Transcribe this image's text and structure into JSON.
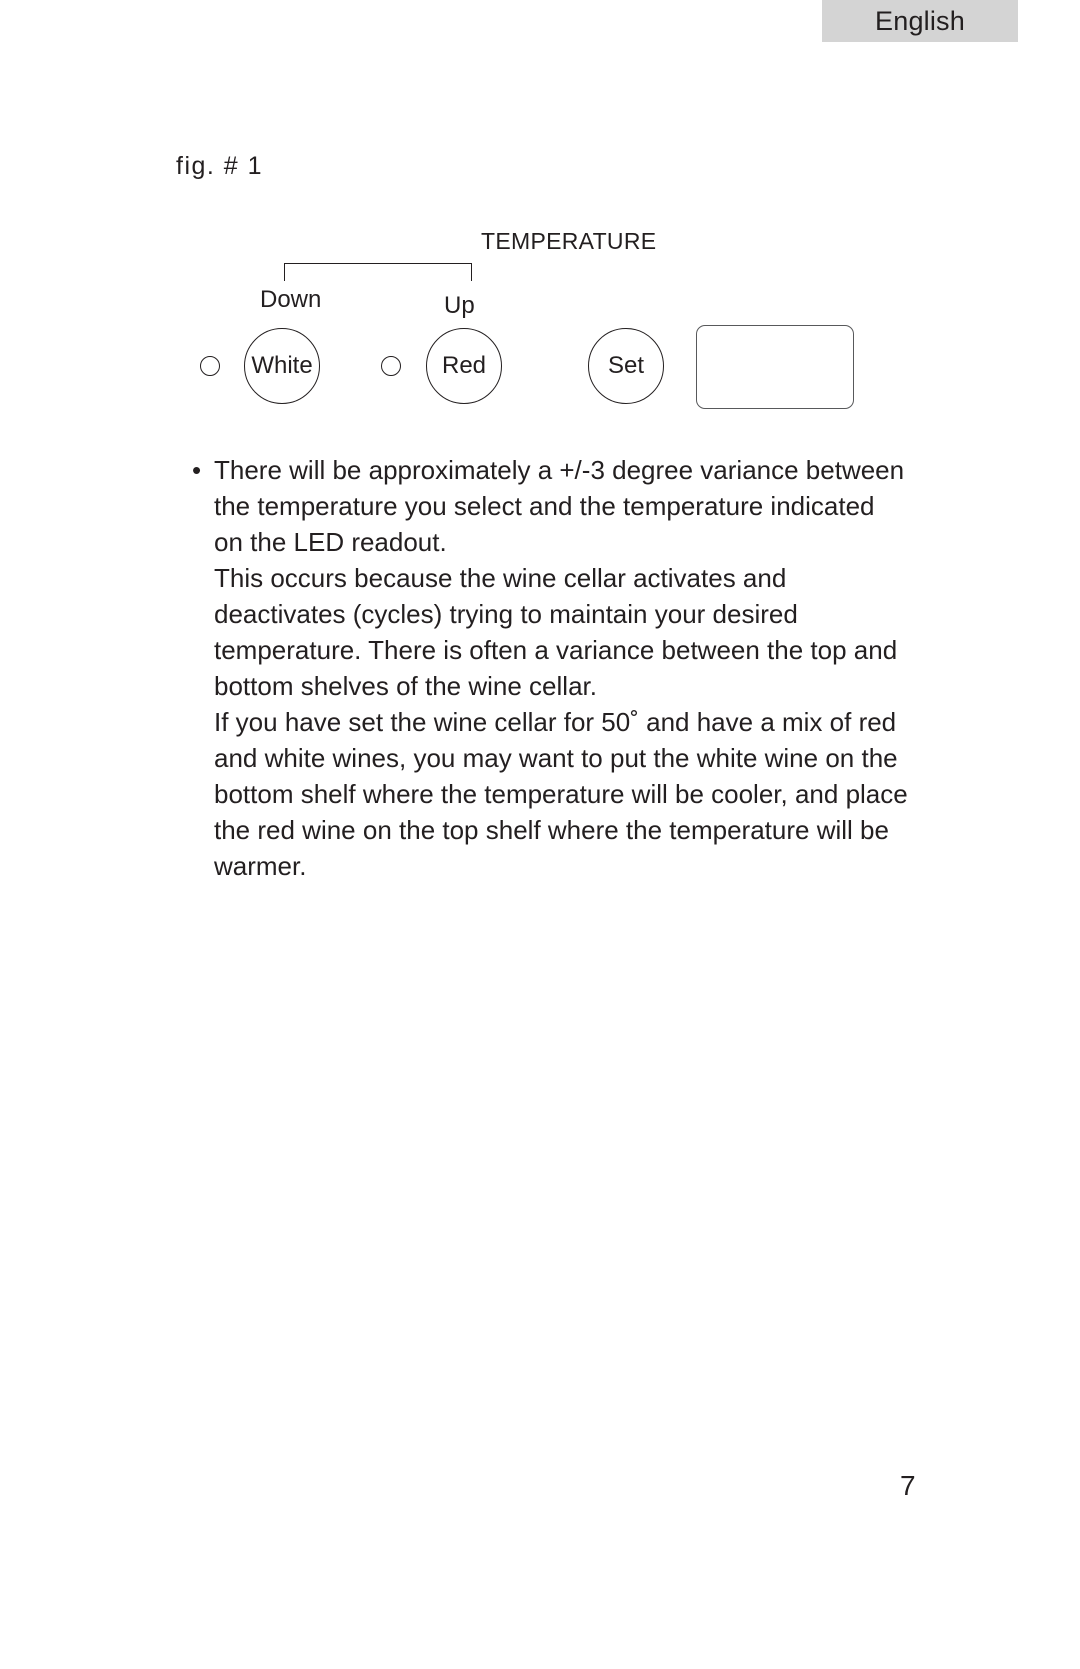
{
  "header": {
    "language_tab": "English",
    "tab_bg": "#d4d4d4"
  },
  "figure": {
    "caption": "fig. # 1",
    "panel": {
      "group_label": "TEMPERATURE",
      "down_label": "Down",
      "up_label": "Up",
      "buttons": [
        {
          "name": "white",
          "label": "White"
        },
        {
          "name": "red",
          "label": "Red"
        },
        {
          "name": "set",
          "label": "Set"
        }
      ],
      "indicators": [
        {
          "name": "white-led"
        },
        {
          "name": "red-led"
        }
      ],
      "readout": {
        "name": "led-readout",
        "value": ""
      }
    }
  },
  "content": {
    "bullet_marker": "•",
    "bullet_text": "There will be approximately a +/-3 degree variance  between the temperature you select and the temperature indicated on the LED readout.",
    "paragraph_2": "This occurs because the wine cellar activates and deactivates (cycles) trying to maintain your desired temperature. There is often a variance between the top and bottom shelves of the wine cellar.",
    "paragraph_3": "If you have set the wine cellar for 50˚ and have a mix of red and white wines, you may want to put the white wine on the bottom shelf where the temperature will be cooler, and place the red wine on the top shelf where the temperature will be warmer."
  },
  "footer": {
    "page_number": "7"
  },
  "colors": {
    "text": "#231f20",
    "tab_background": "#d4d4d4",
    "stroke": "#231f20",
    "readout_stroke": "#58595b"
  }
}
